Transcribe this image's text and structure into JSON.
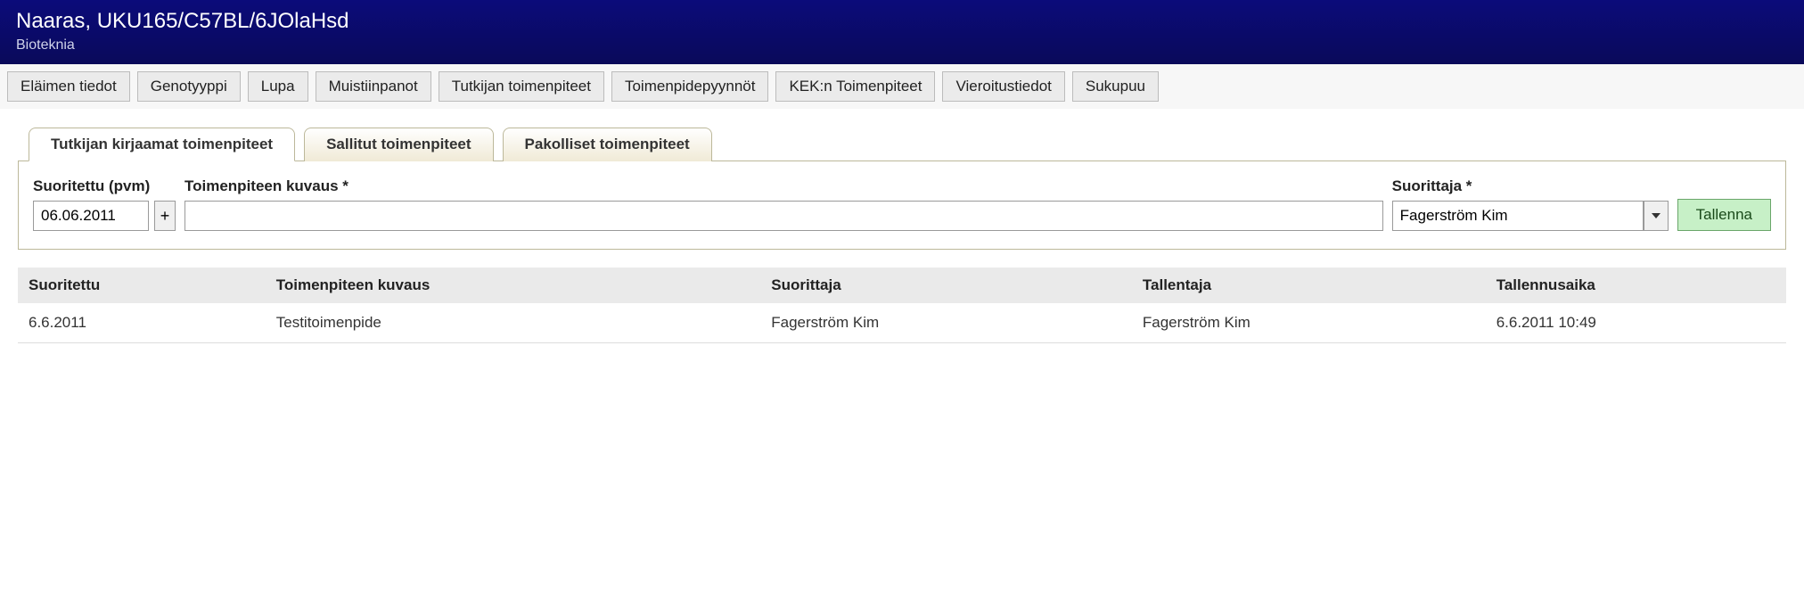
{
  "header": {
    "title": "Naaras, UKU165/C57BL/6JOlaHsd",
    "subtitle": "Bioteknia"
  },
  "navbar": {
    "items": [
      "Eläimen tiedot",
      "Genotyyppi",
      "Lupa",
      "Muistiinpanot",
      "Tutkijan toimenpiteet",
      "Toimenpidepyynnöt",
      "KEK:n Toimenpiteet",
      "Vieroitustiedot",
      "Sukupuu"
    ]
  },
  "tabs": {
    "items": [
      {
        "label": "Tutkijan kirjaamat toimenpiteet",
        "active": true
      },
      {
        "label": "Sallitut toimenpiteet",
        "active": false
      },
      {
        "label": "Pakolliset toimenpiteet",
        "active": false
      }
    ]
  },
  "form": {
    "date_label": "Suoritettu (pvm)",
    "date_value": "06.06.2011",
    "plus_label": "+",
    "description_label": "Toimenpiteen kuvaus *",
    "description_value": "",
    "performer_label": "Suorittaja *",
    "performer_value": "Fagerström Kim",
    "save_label": "Tallenna"
  },
  "table": {
    "headers": {
      "suoritettu": "Suoritettu",
      "kuvaus": "Toimenpiteen kuvaus",
      "suorittaja": "Suorittaja",
      "tallentaja": "Tallentaja",
      "tallennusaika": "Tallennusaika"
    },
    "rows": [
      {
        "suoritettu": "6.6.2011",
        "kuvaus": "Testitoimenpide",
        "suorittaja": "Fagerström Kim",
        "tallentaja": "Fagerström Kim",
        "tallennusaika": "6.6.2011 10:49"
      }
    ]
  }
}
